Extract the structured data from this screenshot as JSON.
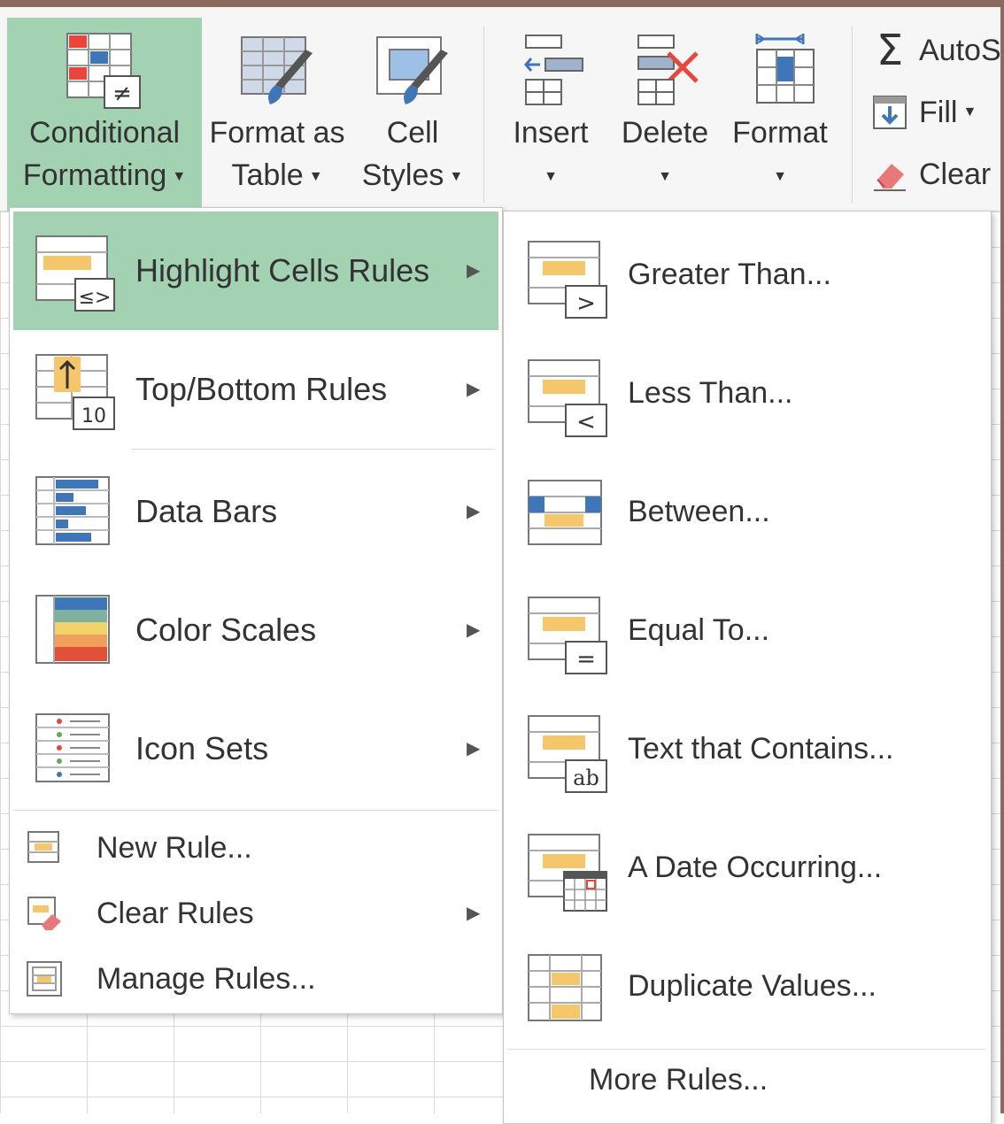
{
  "ribbon": {
    "styles": [
      {
        "label_line1": "Conditional",
        "label_line2": "Formatting",
        "has_dropdown": true,
        "icon": "conditional-formatting-icon",
        "active": true
      },
      {
        "label_line1": "Format as",
        "label_line2": "Table",
        "has_dropdown": true,
        "icon": "format-as-table-icon"
      },
      {
        "label_line1": "Cell",
        "label_line2": "Styles",
        "has_dropdown": true,
        "icon": "cell-styles-icon"
      }
    ],
    "cells": [
      {
        "label": "Insert",
        "has_dropdown": true,
        "icon": "insert-cells-icon"
      },
      {
        "label": "Delete",
        "has_dropdown": true,
        "icon": "delete-cells-icon"
      },
      {
        "label": "Format",
        "has_dropdown": true,
        "icon": "format-cells-icon"
      }
    ],
    "editing": [
      {
        "label": "AutoS",
        "icon": "sigma-icon"
      },
      {
        "label": "Fill",
        "icon": "fill-down-icon"
      },
      {
        "label": "Clear",
        "icon": "eraser-icon"
      }
    ]
  },
  "menu": {
    "items": [
      {
        "label": "Highlight Cells Rules",
        "icon": "highlight-cells-rules-icon",
        "has_submenu": true,
        "highlighted": true
      },
      {
        "label": "Top/Bottom Rules",
        "icon": "top-bottom-rules-icon",
        "has_submenu": true,
        "badge": "10"
      },
      {
        "label": "Data Bars",
        "icon": "data-bars-icon",
        "has_submenu": true
      },
      {
        "label": "Color Scales",
        "icon": "color-scales-icon",
        "has_submenu": true
      },
      {
        "label": "Icon Sets",
        "icon": "icon-sets-icon",
        "has_submenu": true
      }
    ],
    "small_items": [
      {
        "label": "New Rule...",
        "icon": "new-rule-icon",
        "has_submenu": false
      },
      {
        "label": "Clear Rules",
        "icon": "clear-rules-icon",
        "has_submenu": true
      },
      {
        "label": "Manage Rules...",
        "icon": "manage-rules-icon",
        "has_submenu": false
      }
    ]
  },
  "submenu": {
    "items": [
      {
        "label": "Greater Than...",
        "icon": "greater-than-icon",
        "symbol": ">"
      },
      {
        "label": "Less Than...",
        "icon": "less-than-icon",
        "symbol": "<"
      },
      {
        "label": "Between...",
        "icon": "between-icon"
      },
      {
        "label": "Equal To...",
        "icon": "equal-to-icon",
        "symbol": "="
      },
      {
        "label": "Text that Contains...",
        "icon": "text-contains-icon",
        "symbol": "ab"
      },
      {
        "label": "A Date Occurring...",
        "icon": "date-occurring-icon"
      },
      {
        "label": "Duplicate Values...",
        "icon": "duplicate-values-icon"
      }
    ],
    "more_rules": "More Rules..."
  },
  "colors": {
    "highlight": "#a3d2b3",
    "cell_fill": "#f5c76a",
    "bar_blue": "#3f76b8",
    "accent_red": "#e8463b"
  }
}
